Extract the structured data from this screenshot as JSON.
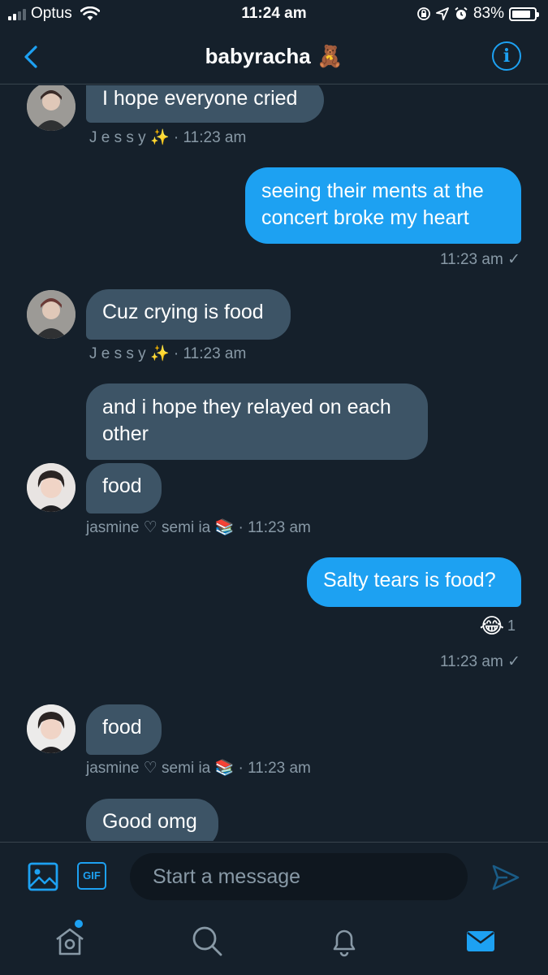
{
  "status_bar": {
    "carrier": "Optus",
    "time": "11:24 am",
    "battery_percent": "83%",
    "battery_level": 0.83
  },
  "header": {
    "title": "babyracha 🧸"
  },
  "messages": {
    "m1": {
      "text": "I hope everyone cried",
      "sender": "J e s s y ✨",
      "time": "· 11:23 am"
    },
    "m2": {
      "text_line1": "seeing their ments at the",
      "text_line2": "concert broke my heart",
      "time": "11:23 am ✓"
    },
    "m3": {
      "text": "Cuz crying is food",
      "sender": "J e s s y ✨",
      "time": "· 11:23 am"
    },
    "m4": {
      "text_line1": "and i hope they relayed on each",
      "text_line2": "other"
    },
    "m5": {
      "text": "food",
      "sender": "jasmine ♡ semi ia 📚",
      "time": "· 11:23 am"
    },
    "m6": {
      "text": "Salty tears is food?",
      "reaction_emoji": "😂",
      "reaction_count": "1",
      "time": "11:23 am ✓"
    },
    "m7": {
      "text": "food",
      "sender": "jasmine ♡ semi ia 📚",
      "time": "· 11:23 am"
    },
    "m8": {
      "text": "Good omg"
    }
  },
  "composer": {
    "gif_label": "GIF",
    "placeholder": "Start a message"
  },
  "tabbar": {
    "items": [
      "home-icon",
      "search-icon",
      "notifications-icon",
      "messages-icon"
    ]
  },
  "colors": {
    "background": "#15202b",
    "incoming_bubble": "#3d5466",
    "outgoing_bubble": "#1da1f2",
    "accent": "#1da1f2",
    "meta_text": "#8899a6"
  }
}
